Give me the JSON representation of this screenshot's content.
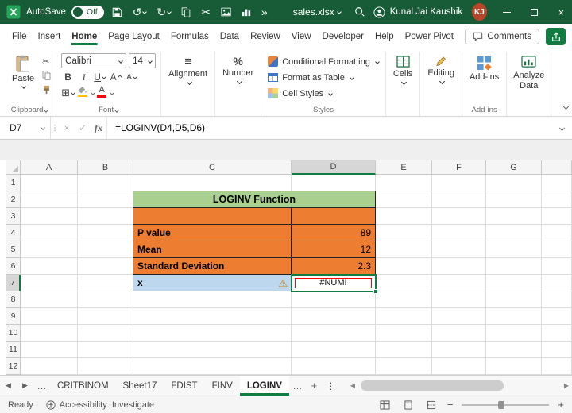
{
  "colors": {
    "titlebar": "#185C37",
    "accent": "#107C41",
    "table-orange": "#ED7D31",
    "table-green": "#A9D08E",
    "row-blue": "#BDD7EE",
    "error-red": "#FF0000",
    "avatar-bg": "#B7472A",
    "fill-yellow": "#FFC000",
    "font-red": "#FF0000",
    "sel-header": "#D6D6D6"
  },
  "icons": {
    "undo": "↺",
    "redo": "↻",
    "scissors": "✂",
    "chevrons_right": "»",
    "close": "×",
    "check": "✓",
    "fx": "fx",
    "kebab": "⋮",
    "ellipsis": "…",
    "plus": "+",
    "minus": "−",
    "prev": "◀",
    "next": "▶",
    "borders": "⊞",
    "align_lines": "≡",
    "percent": "%",
    "warning": "⚠"
  },
  "titlebar": {
    "autosave": "AutoSave",
    "autosave_state": "Off",
    "filename": "sales.xlsx",
    "user": "Kunal Jai Kaushik",
    "initials": "KJ"
  },
  "menubar": {
    "tabs": [
      "File",
      "Insert",
      "Home",
      "Page Layout",
      "Formulas",
      "Data",
      "Review",
      "View",
      "Developer",
      "Help",
      "Power Pivot"
    ],
    "active_tab": "Home",
    "comments": "Comments"
  },
  "ribbon": {
    "paste_label": "Paste",
    "clipboard_group": "Clipboard",
    "font_name": "Calibri",
    "font_size": "14",
    "bold": "B",
    "italic": "I",
    "underline": "U",
    "grow_font": "A",
    "shrink_font": "A",
    "font_color_letter": "A",
    "font_group": "Font",
    "alignment_label": "Alignment",
    "number_label": "Number",
    "conditional_formatting": "Conditional Formatting",
    "format_as_table": "Format as Table",
    "cell_styles": "Cell Styles",
    "styles_group": "Styles",
    "cells_label": "Cells",
    "editing_label": "Editing",
    "addins_label": "Add-ins",
    "addins_group": "Add-ins",
    "analyze_data": "Analyze Data"
  },
  "formula_bar": {
    "name_box": "D7",
    "formula": "=LOGINV(D4,D5,D6)"
  },
  "grid": {
    "columns": [
      "A",
      "B",
      "C",
      "D",
      "E",
      "F",
      "G"
    ],
    "rows": [
      "1",
      "2",
      "3",
      "4",
      "5",
      "6",
      "7",
      "8",
      "9",
      "10",
      "11",
      "12"
    ],
    "selected_column": "D",
    "selected_row": "7",
    "active_cell": "D7"
  },
  "table": {
    "title": "LOGINV Function",
    "rows": [
      {
        "label": "P value",
        "value": "89"
      },
      {
        "label": "Mean",
        "value": "12"
      },
      {
        "label": "Standard Deviation",
        "value": "2.3"
      }
    ],
    "x_label": "x",
    "result": "#NUM!"
  },
  "sheet_tabs": {
    "tabs": [
      "CRITBINOM",
      "Sheet17",
      "FDIST",
      "FINV",
      "LOGINV"
    ],
    "active": "LOGINV"
  },
  "status_bar": {
    "ready": "Ready",
    "accessibility": "Accessibility: Investigate"
  }
}
